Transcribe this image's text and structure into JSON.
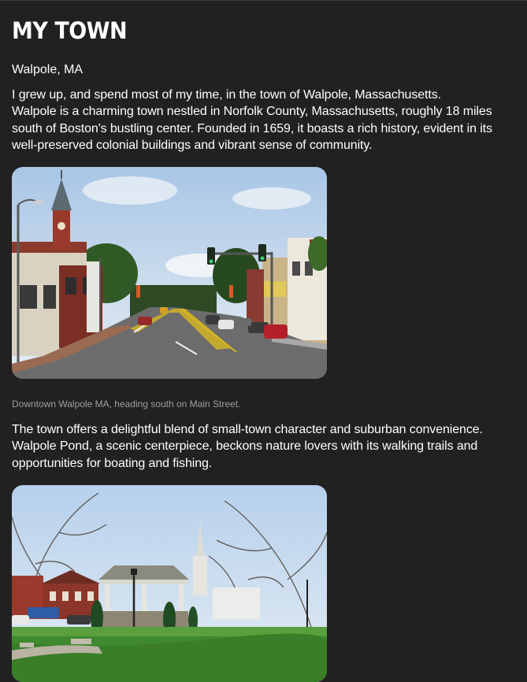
{
  "header": {
    "title": "MY TOWN"
  },
  "location": {
    "subtitle": "Walpole, MA"
  },
  "intro": {
    "line1": "I grew up, and spend most of my time, in the town of Walpole, Massachusetts.",
    "body": "Walpole is a charming town nestled in Norfolk County, Massachusetts, roughly 18 miles south of Boston's bustling center. Founded in 1659, it boasts a rich history, evident in its well-preserved colonial buildings and vibrant sense of community."
  },
  "photos": [
    {
      "caption": "Downtown Walpole MA, heading south on Main Street.",
      "alt": "Downtown Walpole MA, heading south on Main Street."
    },
    {
      "caption": "",
      "alt": "Walpole town common with gazebo"
    }
  ],
  "second_section": {
    "body": "The town offers a delightful blend of small-town character and suburban convenience. Walpole Pond, a scenic centerpiece, beckons nature lovers with its walking trails and opportunities for boating and fishing."
  }
}
